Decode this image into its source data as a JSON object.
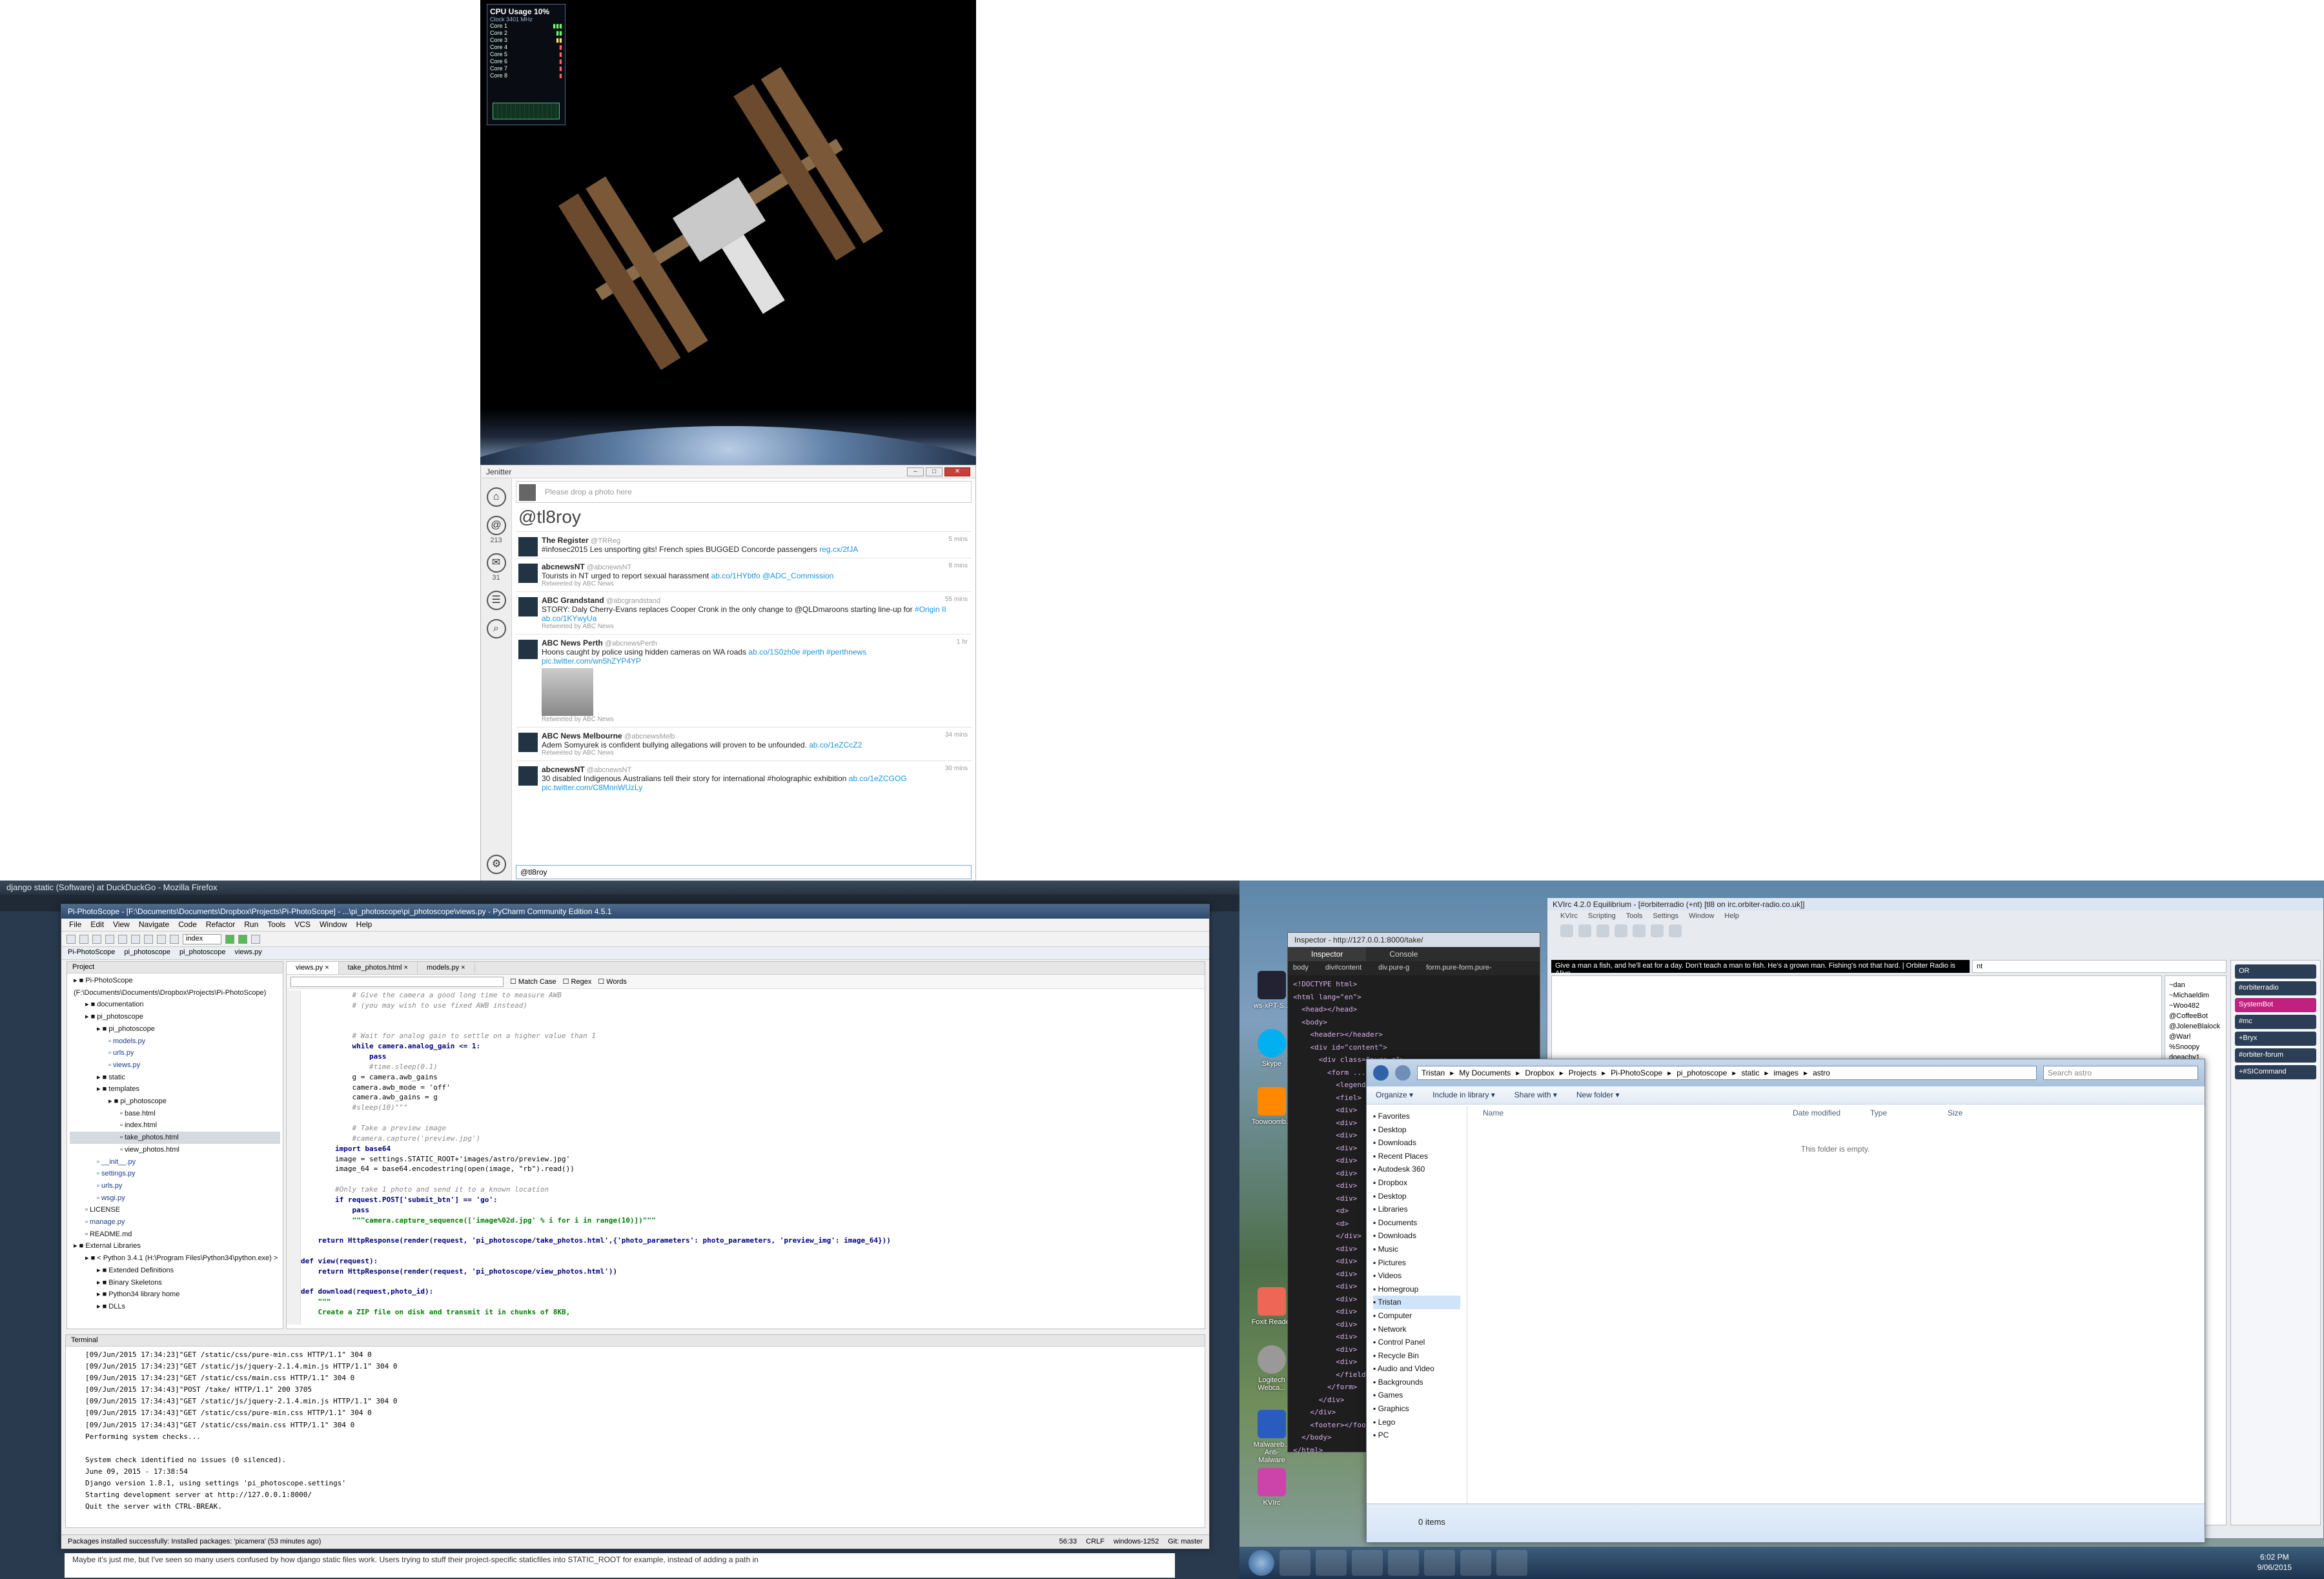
{
  "cpu_widget": {
    "title": "CPU Usage",
    "value": "10%",
    "subtitle": "Clock 3401 MHz",
    "cores": [
      "Core 1",
      "Core 2",
      "Core 3",
      "Core 4",
      "Core 5",
      "Core 6",
      "Core 7",
      "Core 8"
    ]
  },
  "jenitter": {
    "title": "Jenitter",
    "photo_placeholder": "Please drop a photo here",
    "handle": "@tl8roy",
    "counts": {
      "mentions": "213",
      "messages": "31"
    },
    "tweets": [
      {
        "name": "The Register",
        "handle": "@TRReg",
        "time": "5 mins",
        "text": "#infosec2015 Les unsporting gits! French spies BUGGED Concorde passengers",
        "link": "reg.cx/2fJA",
        "retweeted": ""
      },
      {
        "name": "abcnewsNT",
        "handle": "@abcnewsNT",
        "time": "8 mins",
        "text": "Tourists in NT urged to report sexual harassment",
        "link": "ab.co/1HYbtfo @ADC_Commission",
        "retweeted": "Retweeted by ABC News"
      },
      {
        "name": "ABC Grandstand",
        "handle": "@abcgrandstand",
        "time": "55 mins",
        "text": "STORY: Daly Cherry-Evans replaces Cooper Cronk in the only change to @QLDmaroons starting line-up for",
        "link": "#Origin II  ab.co/1KYwyUa",
        "retweeted": "Retweeted by ABC News"
      },
      {
        "name": "ABC News Perth",
        "handle": "@abcnewsPerth",
        "time": "1 hr",
        "text": "Hoons caught by police using hidden cameras on WA roads",
        "link": "ab.co/1S0zh0e #perth #perthnews pic.twitter.com/wn5hZYP4YP",
        "retweeted": "Retweeted by ABC News"
      },
      {
        "name": "ABC News Melbourne",
        "handle": "@abcnewsMelb",
        "time": "34 mins",
        "text": "Adem Somyurek is confident bullying allegations will proven to be unfounded.",
        "link": "ab.co/1eZCcZ2",
        "retweeted": "Retweeted by ABC News"
      },
      {
        "name": "abcnewsNT",
        "handle": "@abcnewsNT",
        "time": "30 mins",
        "text": "30 disabled Indigenous Australians tell their story for international #holographic exhibition",
        "link": "ab.co/1eZCGOG pic.twitter.com/C8MnnWUzLy",
        "retweeted": ""
      }
    ],
    "compose": "@tl8roy"
  },
  "firefox": {
    "title": "django static (Software) at DuckDuckGo - Mozilla Firefox",
    "footer": "Maybe it's just me, but I've seen so many users confused by how django static files work. Users trying to stuff their project-specific staticfiles into STATIC_ROOT for example, instead of adding a path in"
  },
  "pycharm": {
    "title": "Pi-PhotoScope - [F:\\Documents\\Documents\\Dropbox\\Projects\\Pi-PhotoScope] - ...\\pi_photoscope\\pi_photoscope\\views.py - PyCharm Community Edition 4.5.1",
    "menu": [
      "File",
      "Edit",
      "View",
      "Navigate",
      "Code",
      "Refactor",
      "Run",
      "Tools",
      "VCS",
      "Window",
      "Help"
    ],
    "run_config": "index",
    "breadcrumbs": [
      "Pi-PhotoScope",
      "pi_photoscope",
      "pi_photoscope",
      "views.py"
    ],
    "project_label": "Project",
    "tree": [
      {
        "t": "Pi-PhotoScope (F:\\Documents\\Documents\\Dropbox\\Projects\\Pi-PhotoScope)",
        "d": 0
      },
      {
        "t": "documentation",
        "d": 1
      },
      {
        "t": "pi_photoscope",
        "d": 1
      },
      {
        "t": "pi_photoscope",
        "d": 2
      },
      {
        "t": "models.py",
        "d": 3
      },
      {
        "t": "urls.py",
        "d": 3
      },
      {
        "t": "views.py",
        "d": 3
      },
      {
        "t": "static",
        "d": 2
      },
      {
        "t": "templates",
        "d": 2
      },
      {
        "t": "pi_photoscope",
        "d": 3
      },
      {
        "t": "base.html",
        "d": 4
      },
      {
        "t": "index.html",
        "d": 4
      },
      {
        "t": "take_photos.html",
        "d": 4
      },
      {
        "t": "view_photos.html",
        "d": 4
      },
      {
        "t": "__init__.py",
        "d": 2
      },
      {
        "t": "settings.py",
        "d": 2
      },
      {
        "t": "urls.py",
        "d": 2
      },
      {
        "t": "wsgi.py",
        "d": 2
      },
      {
        "t": "LICENSE",
        "d": 1
      },
      {
        "t": "manage.py",
        "d": 1
      },
      {
        "t": "README.md",
        "d": 1
      },
      {
        "t": "External Libraries",
        "d": 0
      },
      {
        "t": "< Python 3.4.1 (H:\\Program Files\\Python34\\python.exe) >",
        "d": 1
      },
      {
        "t": "Extended Definitions",
        "d": 2
      },
      {
        "t": "Binary Skeletons",
        "d": 2
      },
      {
        "t": "Python34 library home",
        "d": 2
      },
      {
        "t": "DLLs",
        "d": 2
      }
    ],
    "editor_tabs": [
      "views.py",
      "take_photos.html",
      "models.py"
    ],
    "find": {
      "match_case": "Match Case",
      "regex": "Regex",
      "words": "Words"
    },
    "code": [
      "            # Give the camera a good long time to measure AWB",
      "            # (you may wish to use fixed AWB instead)",
      "",
      "",
      "            # Wait for analog gain to settle on a higher value than 1",
      "            while camera.analog_gain <= 1:",
      "                pass",
      "                #time.sleep(0.1)",
      "            g = camera.awb_gains",
      "            camera.awb_mode = 'off'",
      "            camera.awb_gains = g",
      "            #sleep(10)\"\"\"",
      "",
      "            # Take a preview image",
      "            #camera.capture('preview.jpg')",
      "        import base64",
      "        image = settings.STATIC_ROOT+'images/astro/preview.jpg'",
      "        image_64 = base64.encodestring(open(image, \"rb\").read())",
      "",
      "        #Only take 1 photo and send it to a known location",
      "        if request.POST['submit_btn'] == 'go':",
      "            pass",
      "            \"\"\"camera.capture_sequence(['image%02d.jpg' % i for i in range(10)])\"\"\"",
      "",
      "    return HttpResponse(render(request, 'pi_photoscope/take_photos.html',{'photo_parameters': photo_parameters, 'preview_img': image_64}))",
      "",
      "def view(request):",
      "    return HttpResponse(render(request, 'pi_photoscope/view_photos.html'))",
      "",
      "def download(request,photo_id):",
      "    \"\"\"",
      "    Create a ZIP file on disk and transmit it in chunks of 8KB,"
    ],
    "terminal_label": "Terminal",
    "terminal": [
      "[09/Jun/2015 17:34:23]\"GET /static/css/pure-min.css HTTP/1.1\" 304 0",
      "[09/Jun/2015 17:34:23]\"GET /static/js/jquery-2.1.4.min.js HTTP/1.1\" 304 0",
      "[09/Jun/2015 17:34:23]\"GET /static/css/main.css HTTP/1.1\" 304 0",
      "[09/Jun/2015 17:34:43]\"POST /take/ HTTP/1.1\" 200 3705",
      "[09/Jun/2015 17:34:43]\"GET /static/js/jquery-2.1.4.min.js HTTP/1.1\" 304 0",
      "[09/Jun/2015 17:34:43]\"GET /static/css/pure-min.css HTTP/1.1\" 304 0",
      "[09/Jun/2015 17:34:43]\"GET /static/css/main.css HTTP/1.1\" 304 0",
      "Performing system checks...",
      "",
      "System check identified no issues (0 silenced).",
      "June 09, 2015 - 17:38:54",
      "Django version 1.8.1, using settings 'pi_photoscope.settings'",
      "Starting development server at http://127.0.0.1:8000/",
      "Quit the server with CTRL-BREAK."
    ],
    "status": {
      "message": "Packages installed successfully: Installed packages: 'picamera' (53 minutes ago)",
      "pos": "56:33",
      "eol": "CRLF",
      "enc": "windows-1252",
      "vcs": "Git: master"
    }
  },
  "inspector": {
    "title": "Inspector - http://127.0.0.1:8000/take/",
    "tabs": [
      "Inspector",
      "Console"
    ],
    "crumbs": [
      "body",
      "div#content",
      "div.pure-g",
      "form.pure-form.pure-"
    ],
    "dom": [
      "<!DOCTYPE html>",
      "<html lang=\"en\">",
      "  <head></head>",
      "  <body>",
      "    <header></header>",
      "    <div id=\"content\">",
      "      <div class=\"pure-g\">",
      "        <form ...>",
      "          <legend>",
      "          <fiel>",
      "          <div>",
      "          <div>",
      "          <div>",
      "          <div>",
      "          <div>",
      "          <div>",
      "          <div>",
      "          <div>",
      "          <d>",
      "          <d>",
      "          </div>",
      "          <div>",
      "          <div>",
      "          <div>",
      "          <div>",
      "          <div>",
      "          <div>",
      "          <div>",
      "          <div>",
      "          <div>",
      "          <div>",
      "          </fieldset>",
      "        </form>",
      "      </div>",
      "    </div>",
      "    <footer></footer>",
      "  </body>",
      "</html>"
    ]
  },
  "kvirc": {
    "title": "KVIrc 4.2.0 Equilibrium - [#orbiterradio (+nt) [tl8 on irc.orbiter-radio.co.uk]]",
    "menu": [
      "KVIrc",
      "Scripting",
      "Tools",
      "Settings",
      "Window",
      "Help"
    ],
    "topic": "Give a man a fish, and he'll eat for a day. Don't teach a man to fish. He's a grown man. Fishing's not that hard. | Orbiter Radio is Alive",
    "mode": "nt",
    "users": [
      "~dan",
      "~Michaeldim",
      "~Woo482",
      "@CoffeeBot",
      "@JoleneBlalock",
      "@Warl",
      "%Snoopy",
      "doeachy1"
    ],
    "channels": [
      "OR",
      "#orbiterradio",
      "SystemBot",
      "#mc",
      "+Bryx",
      "#orbiter-forum",
      "+#SICommand"
    ]
  },
  "explorer": {
    "path": [
      "Tristan",
      "My Documents",
      "Dropbox",
      "Projects",
      "Pi-PhotoScope",
      "pi_photoscope",
      "static",
      "images",
      "astro"
    ],
    "search": "Search astro",
    "commands": [
      "Organize",
      "Include in library",
      "Share with",
      "New folder"
    ],
    "columns": [
      "Name",
      "Date modified",
      "Type",
      "Size"
    ],
    "empty": "This folder is empty.",
    "nav": [
      "Favorites",
      "Desktop",
      "Downloads",
      "Recent Places",
      "Autodesk 360",
      "Dropbox",
      "",
      "Desktop",
      "Libraries",
      "Documents",
      "Downloads",
      "Music",
      "Pictures",
      "Videos",
      "Homegroup",
      "Tristan",
      "Computer",
      "Network",
      "Control Panel",
      "Recycle Bin",
      "Audio and Video",
      "Backgrounds",
      "Games",
      "Graphics",
      "Lego",
      "PC"
    ],
    "items": "0 items"
  },
  "desktop_icons": [
    "ws-xPT-S...",
    "Skype",
    "Toowoomb...",
    "Foxit Reader",
    "Logitech Webca...",
    "Malwareb... Anti-Malware",
    "KVIrc"
  ],
  "clock": {
    "time": "6:02 PM",
    "date": "9/06/2015"
  },
  "colors": {
    "pycharm_title": "#3d5a80",
    "kvirc_channel": "#2b3e55",
    "kvirc_active": "#c02080"
  }
}
